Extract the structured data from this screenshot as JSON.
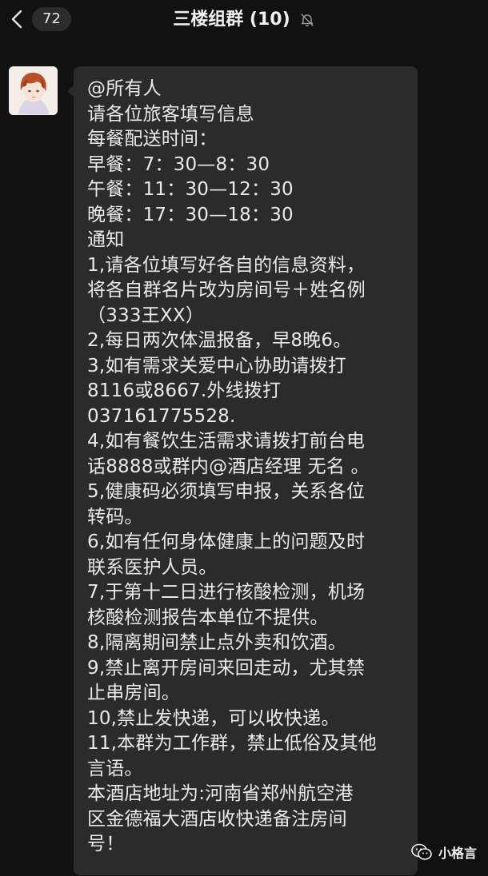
{
  "header": {
    "back_icon": "chevron-left-icon",
    "unread_count": "72",
    "title": "三楼组群 (10)",
    "mute_icon": "bell-slash-icon"
  },
  "message": {
    "lines": [
      "@所有人",
      "请各位旅客填写信息",
      "每餐配送时间：",
      "早餐：7：30—8：30",
      "午餐：11：30—12：30",
      "晚餐：17：30—18：30",
      "通知",
      "1,请各位填写好各自的信息资料，",
      "将各自群名片改为房间号＋姓名例",
      "（333王XX）",
      "2,每日两次体温报备，早8晚6。",
      "3,如有需求关爱中心协助请拨打",
      "8116或8667.外线拨打",
      "037161775528.",
      "4,如有餐饮生活需求请拨打前台电",
      "话8888或群内@酒店经理 无名 。",
      "5,健康码必须填写申报，关系各位",
      "转码。",
      "6,如有任何身体健康上的问题及时",
      "联系医护人员。",
      "7,于第十二日进行核酸检测，机场",
      "核酸检测报告本单位不提供。",
      "8,隔离期间禁止点外卖和饮酒。",
      "9,禁止离开房间来回走动，尤其禁",
      "止串房间。",
      "10,禁止发快递，可以收快递。",
      "11,本群为工作群，禁止低俗及其他",
      "言语。",
      "本酒店地址为:河南省郑州航空港",
      "区金德福大酒店收快递备注房间",
      "号！"
    ]
  },
  "watermark": {
    "icon": "wechat-channel-icon",
    "text": "小格言"
  },
  "colors": {
    "background": "#111111",
    "bubble": "#2b2b2b",
    "text": "#e9e9e9"
  }
}
